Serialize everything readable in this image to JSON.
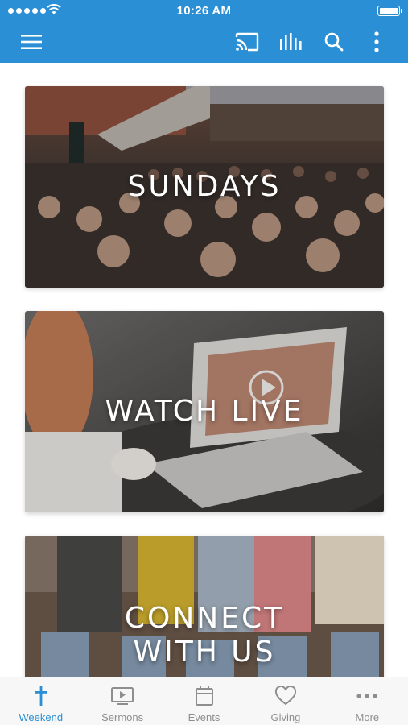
{
  "status_bar": {
    "time": "10:26 AM"
  },
  "header": {
    "menu_icon": "hamburger-menu-icon",
    "actions": [
      "cast-icon",
      "audio-bars-icon",
      "search-icon",
      "more-vertical-icon"
    ]
  },
  "cards": [
    {
      "label": "SUNDAYS"
    },
    {
      "label": "WATCH LIVE"
    },
    {
      "label_line1": "CONNECT",
      "label_line2": "WITH US"
    }
  ],
  "tabs": [
    {
      "label": "Weekend",
      "icon": "cross-icon",
      "active": true
    },
    {
      "label": "Sermons",
      "icon": "video-player-icon",
      "active": false
    },
    {
      "label": "Events",
      "icon": "calendar-icon",
      "active": false
    },
    {
      "label": "Giving",
      "icon": "heart-icon",
      "active": false
    },
    {
      "label": "More",
      "icon": "more-horizontal-icon",
      "active": false
    }
  ],
  "colors": {
    "brand_blue": "#2a8fd4",
    "tab_inactive": "#8e8e8e",
    "tabbar_bg": "#f7f7f7"
  }
}
